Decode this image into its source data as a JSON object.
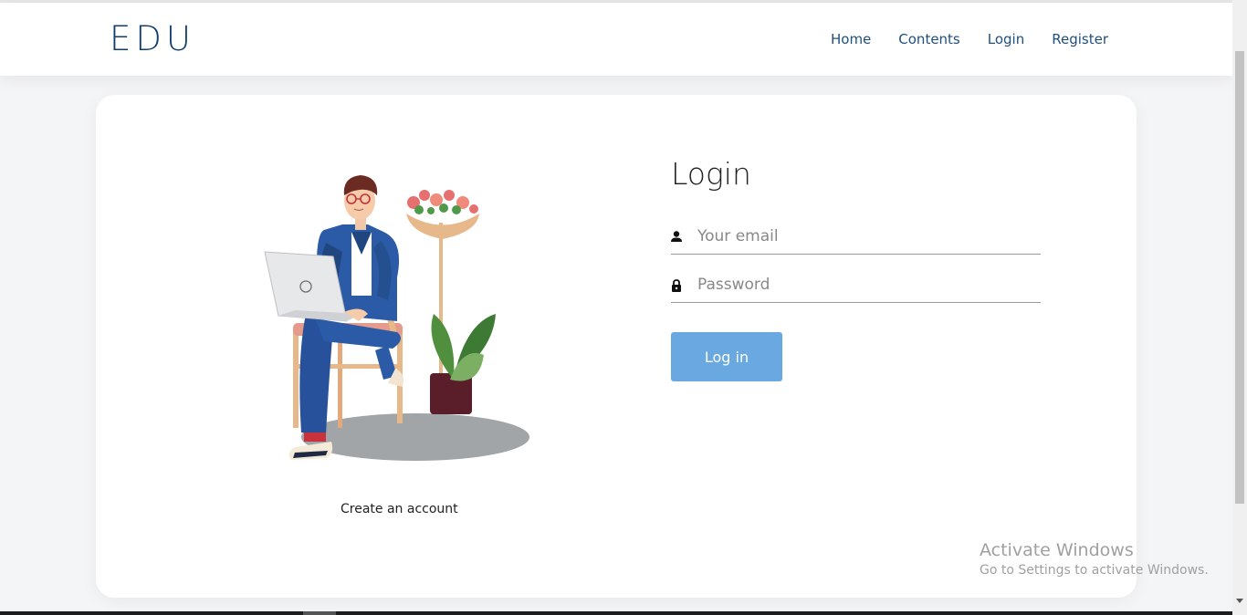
{
  "brand": {
    "name": "EDU"
  },
  "nav": {
    "items": [
      "Home",
      "Contents",
      "Login",
      "Register"
    ]
  },
  "illustration": {
    "alt": "person-with-laptop-illustration"
  },
  "signup": {
    "label": "Create an account"
  },
  "login_form": {
    "title": "Login",
    "email_placeholder": "Your email",
    "password_placeholder": "Password",
    "submit_label": "Log in"
  },
  "watermark": {
    "title": "Activate Windows",
    "subtitle": "Go to Settings to activate Windows."
  },
  "colors": {
    "brand": "#0f3c6e",
    "nav_link": "#1f4f7e",
    "button": "#6aa8e2",
    "background": "#f4f5f7"
  }
}
